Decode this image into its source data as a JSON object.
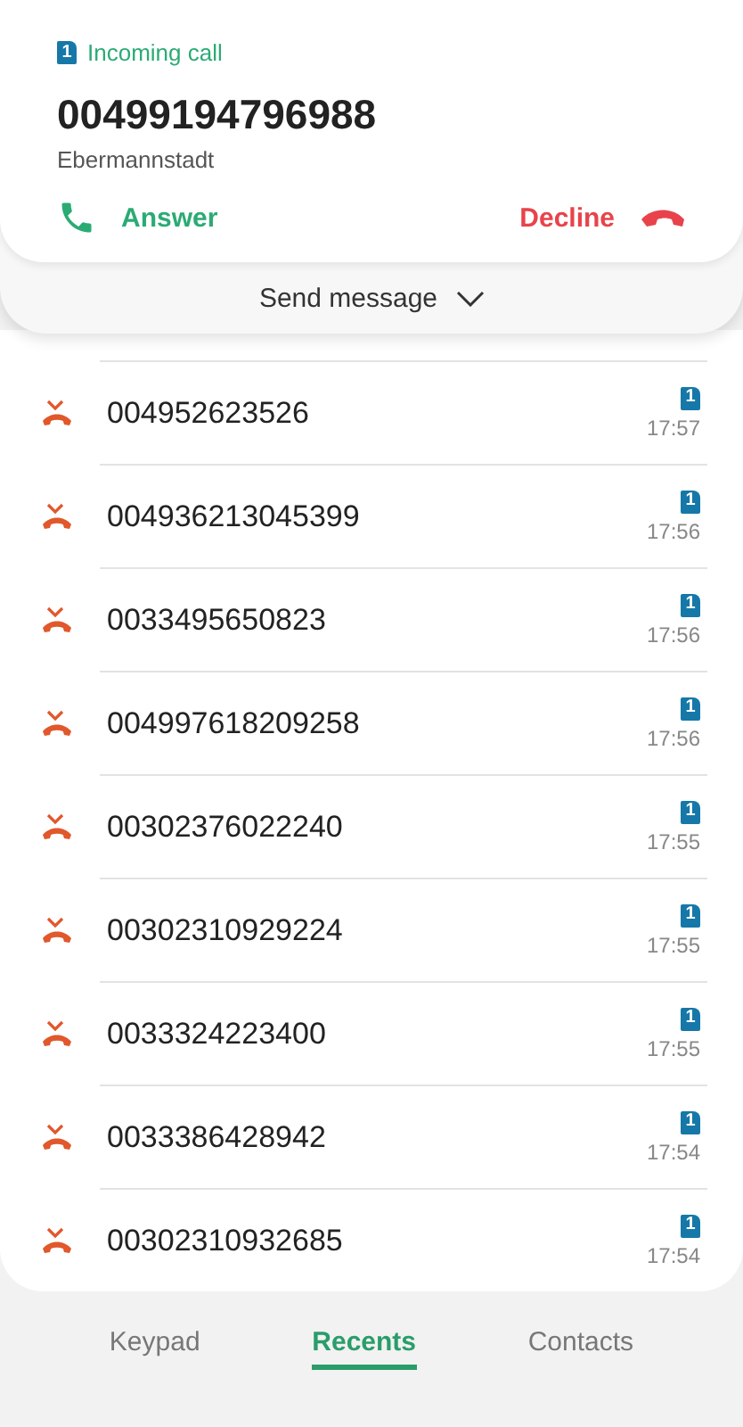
{
  "incoming_call": {
    "sim": "1",
    "label": "Incoming call",
    "number": "00499194796988",
    "location": "Ebermannstadt",
    "answer": "Answer",
    "decline": "Decline"
  },
  "send_message": "Send message",
  "calls": [
    {
      "number": "004952623526",
      "sim": "1",
      "time": "17:57"
    },
    {
      "number": "004936213045399",
      "sim": "1",
      "time": "17:56"
    },
    {
      "number": "0033495650823",
      "sim": "1",
      "time": "17:56"
    },
    {
      "number": "004997618209258",
      "sim": "1",
      "time": "17:56"
    },
    {
      "number": "00302376022240",
      "sim": "1",
      "time": "17:55"
    },
    {
      "number": "00302310929224",
      "sim": "1",
      "time": "17:55"
    },
    {
      "number": "0033324223400",
      "sim": "1",
      "time": "17:55"
    },
    {
      "number": "0033386428942",
      "sim": "1",
      "time": "17:54"
    },
    {
      "number": "00302310932685",
      "sim": "1",
      "time": "17:54"
    }
  ],
  "tabs": [
    {
      "label": "Keypad",
      "selected": false
    },
    {
      "label": "Recents",
      "selected": true
    },
    {
      "label": "Contacts",
      "selected": false
    }
  ]
}
